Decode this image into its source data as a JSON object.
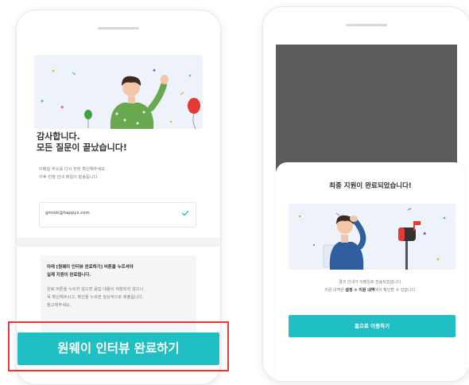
{
  "left_screen": {
    "title_line1": "감사합니다.",
    "title_line2": "모든 질문이 끝났습니다!",
    "description_line1": "이메일 주소를 다시 한번 확인해주세요.",
    "description_line2": "이후 진행 안내 메일이 발송됩니다.",
    "email_value": "gmrok@happyx.com",
    "notice_bold_line1": "아래 [원웨이 인터뷰 완료하기] 버튼을 누르셔야",
    "notice_bold_line2": "실제 지원이 완료됩니다.",
    "notice_body_line1": "완료 버튼을 누르지 않으면 응답 내용이 저장되지 않으니",
    "notice_body_line2": "꼭 확인해주시고, 확인을 누르면 정상적으로 제출됩니다.",
    "notice_body_line3": "참고해주세요.",
    "cta_label": "원웨이 인터뷰 완료하기"
  },
  "right_screen": {
    "sheet_title": "최종 지원이 완료되었습니다!",
    "desc_line1": "결과 안내가 이메일로 전송되었습니다.",
    "desc_prefix": "지원 내역은 ",
    "desc_bold": "설정 > 지원 내역",
    "desc_suffix": "에서 확인할 수 있습니다.",
    "button_label": "홈으로 이동하기"
  },
  "colors": {
    "accent": "#1fbfc3",
    "highlight_outline": "#e53935",
    "hero_background": "#eef2fb",
    "video_placeholder": "#5d5d5d"
  }
}
